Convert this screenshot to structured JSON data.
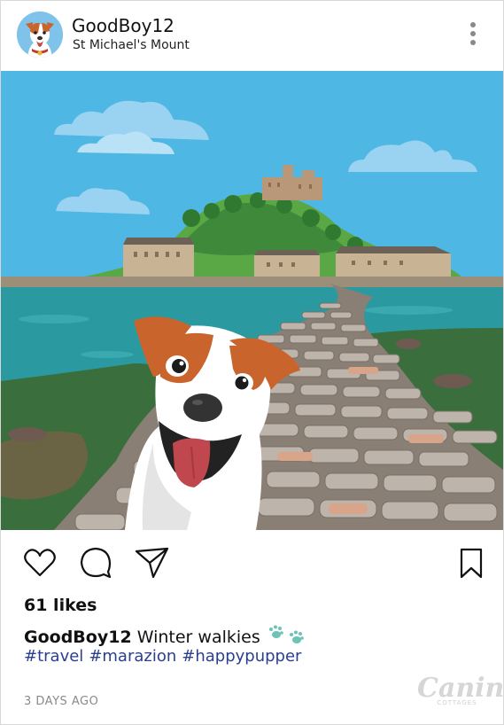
{
  "post": {
    "username": "GoodBoy12",
    "location": "St Michael's Mount",
    "likes": "61 likes",
    "caption_user": "GoodBoy12",
    "caption_text": "Winter walkies",
    "hashtags": [
      "#travel",
      "#marazion",
      "#happypupper"
    ],
    "time": "3 DAYS AGO"
  },
  "brand": {
    "name": "Canine",
    "sub": "COTTAGES"
  },
  "icons": [
    "more-vertical-icon",
    "heart-icon",
    "comment-icon",
    "share-icon",
    "bookmark-icon",
    "paw-icon"
  ],
  "colors": {
    "sky": "#4fb7e3",
    "sea": "#2a9aa0",
    "hashtag": "#2b3f8f",
    "paw": "#6ec3b8"
  }
}
